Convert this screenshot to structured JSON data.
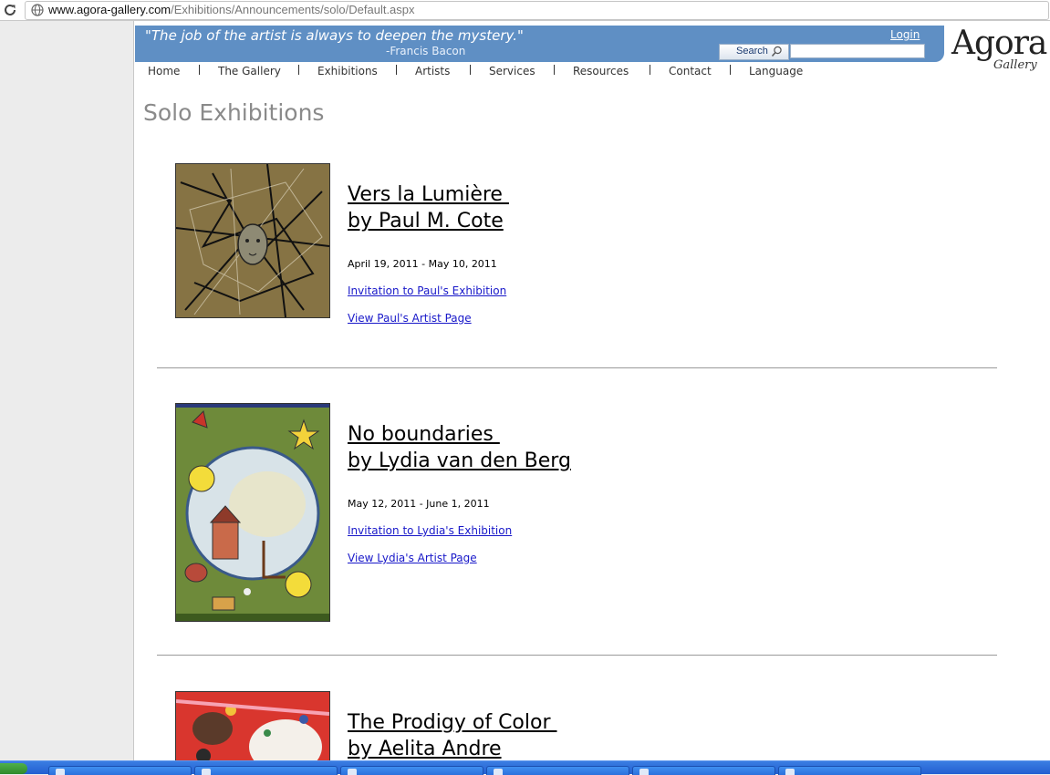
{
  "browser": {
    "url_domain": "www.agora-gallery.com",
    "url_path": "/Exhibitions/Announcements/solo/Default.aspx"
  },
  "header": {
    "quote": "\"The job of the artist is always to deepen the mystery.\"",
    "quote_author": "-Francis Bacon",
    "login_label": "Login",
    "search_label": "Search",
    "search_value": "",
    "logo_main": "Agora",
    "logo_sub": "Gallery"
  },
  "nav": {
    "items": [
      {
        "label": "Home"
      },
      {
        "label": "The Gallery"
      },
      {
        "label": "Exhibitions"
      },
      {
        "label": "Artists"
      },
      {
        "label": "Services"
      },
      {
        "label": "Resources"
      },
      {
        "label": "Contact"
      },
      {
        "label": "Language"
      }
    ]
  },
  "page": {
    "title": "Solo Exhibitions"
  },
  "exhibitions": [
    {
      "title_line1": "Vers la Lumière ",
      "title_line2": "by Paul M. Cote",
      "dates": "April 19, 2011 - May 10, 2011",
      "invitation_link": "Invitation to Paul's Exhibition",
      "artist_link": "View Paul's Artist Page"
    },
    {
      "title_line1": "No boundaries ",
      "title_line2": "by Lydia van den Berg",
      "dates": "May 12, 2011 - June 1, 2011",
      "invitation_link": "Invitation to Lydia's Exhibition",
      "artist_link": "View Lydia's Artist Page"
    },
    {
      "title_line1": "The Prodigy of Color ",
      "title_line2": "by Aelita Andre"
    }
  ],
  "colors": {
    "banner": "#5f8fc4",
    "link": "#1818c9",
    "title_gray": "#8a8a8a",
    "taskbar": "#235fd1"
  }
}
